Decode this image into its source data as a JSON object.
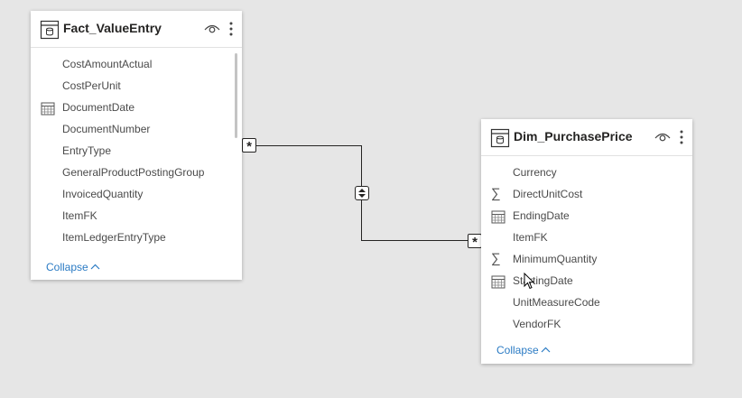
{
  "tables": [
    {
      "title": "Fact_ValueEntry",
      "fields": [
        {
          "label": "CostAmountActual",
          "icon": ""
        },
        {
          "label": "CostPerUnit",
          "icon": ""
        },
        {
          "label": "DocumentDate",
          "icon": "calendar-icon"
        },
        {
          "label": "DocumentNumber",
          "icon": ""
        },
        {
          "label": "EntryType",
          "icon": ""
        },
        {
          "label": "GeneralProductPostingGroup",
          "icon": ""
        },
        {
          "label": "InvoicedQuantity",
          "icon": ""
        },
        {
          "label": "ItemFK",
          "icon": ""
        },
        {
          "label": "ItemLedgerEntryType",
          "icon": ""
        }
      ],
      "collapse_label": "Collapse"
    },
    {
      "title": "Dim_PurchasePrice",
      "fields": [
        {
          "label": "Currency",
          "icon": ""
        },
        {
          "label": "DirectUnitCost",
          "icon": "sum-icon"
        },
        {
          "label": "EndingDate",
          "icon": "calendar-icon"
        },
        {
          "label": "ItemFK",
          "icon": ""
        },
        {
          "label": "MinimumQuantity",
          "icon": "sum-icon"
        },
        {
          "label": "StartingDate",
          "icon": "calendar-icon"
        },
        {
          "label": "UnitMeasureCode",
          "icon": ""
        },
        {
          "label": "VendorFK",
          "icon": ""
        }
      ],
      "collapse_label": "Collapse"
    }
  ],
  "relationship": {
    "from_cardinality": "*",
    "to_cardinality": "*",
    "cross_filter": "both"
  },
  "colors": {
    "canvas": "#e6e6e6",
    "link": "#2b7bc4",
    "line": "#252423"
  }
}
